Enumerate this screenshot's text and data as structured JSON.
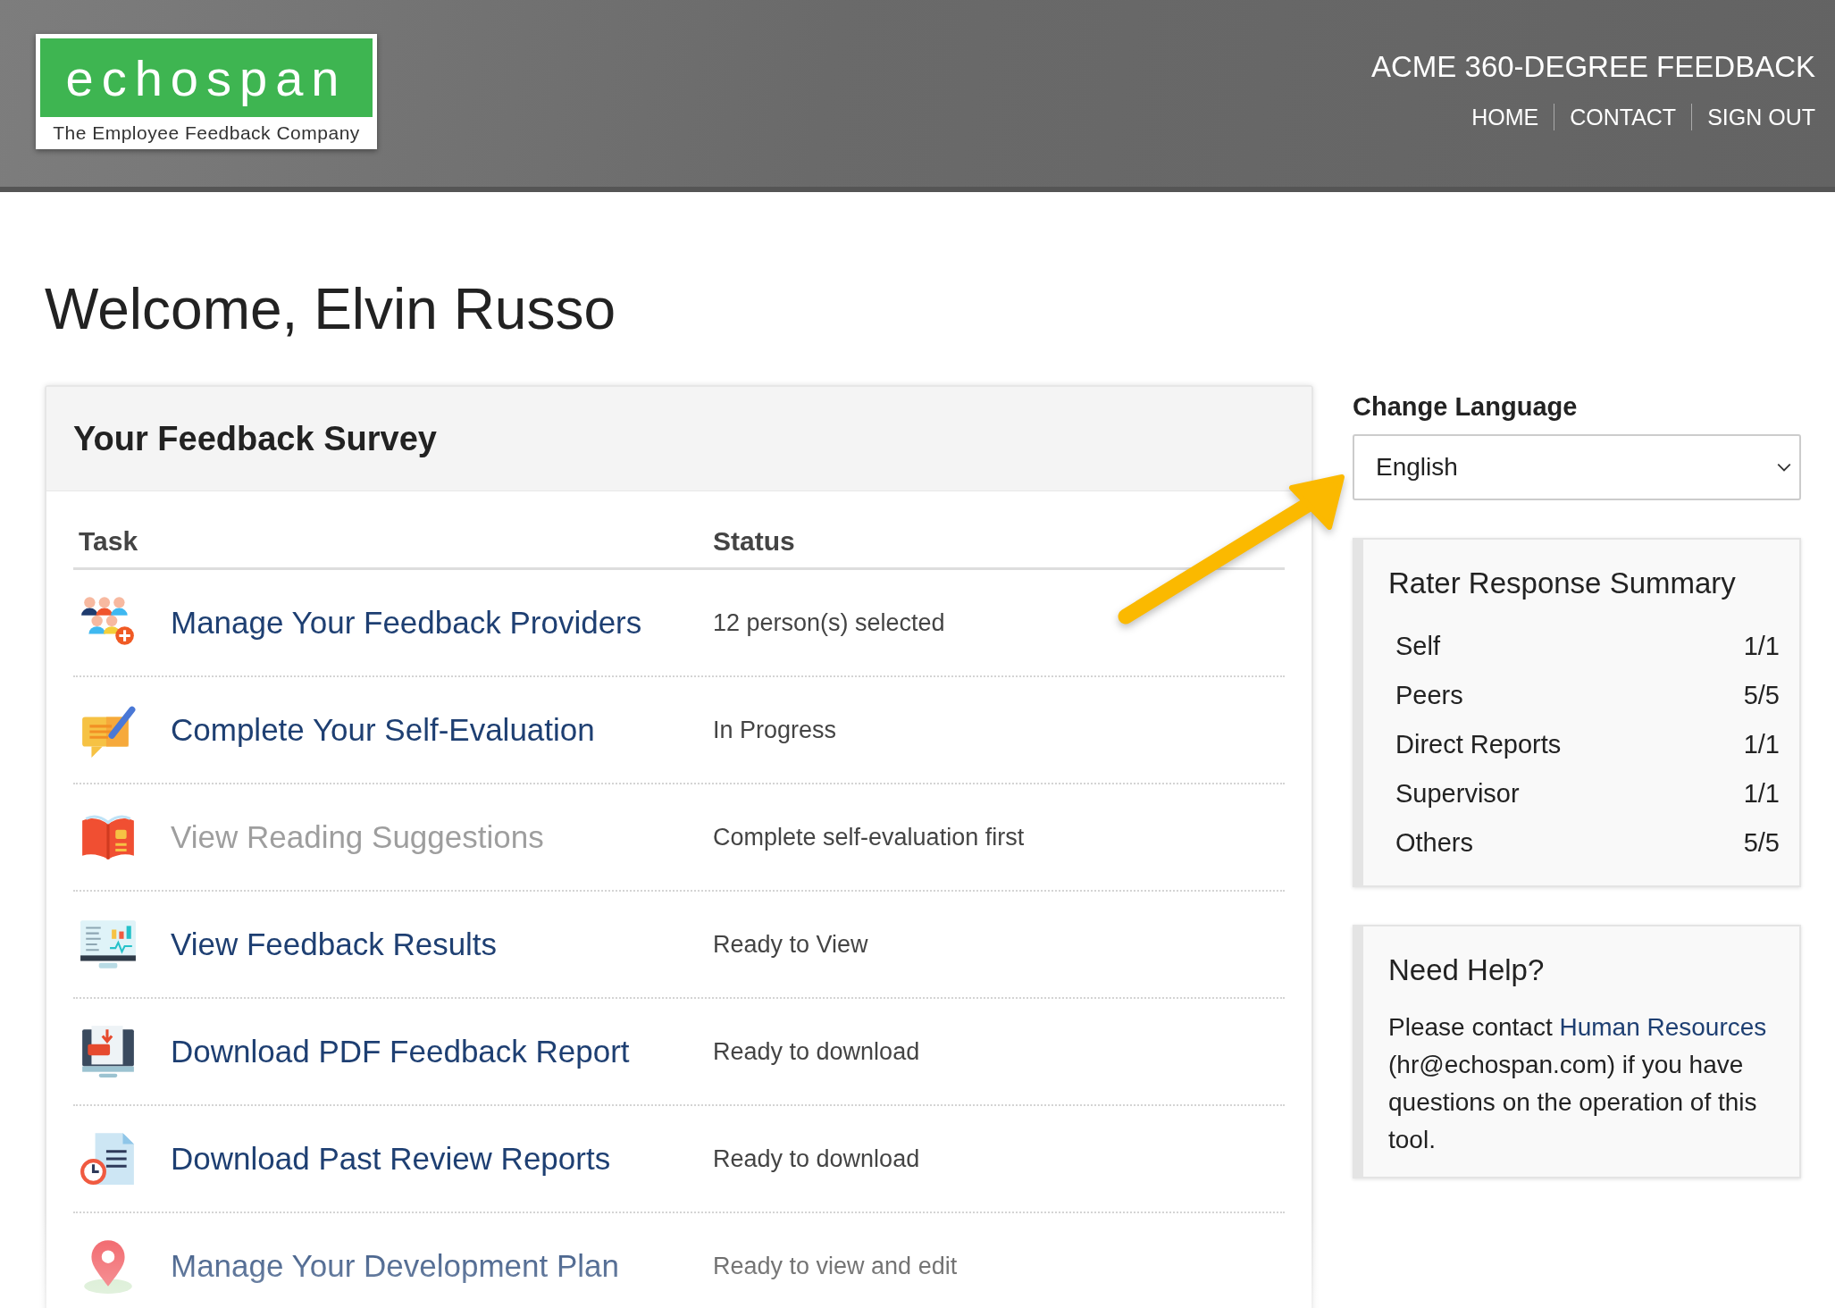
{
  "header": {
    "logo": {
      "wordmark": "echospan",
      "tagline": "The Employee Feedback Company"
    },
    "app_title": "ACME 360-DEGREE FEEDBACK",
    "nav": [
      "HOME",
      "CONTACT",
      "SIGN OUT"
    ]
  },
  "welcome": "Welcome, Elvin Russo",
  "survey": {
    "title": "Your Feedback Survey",
    "columns": [
      "Task",
      "Status"
    ],
    "tasks": [
      {
        "kind": "people",
        "label": "Manage Your Feedback Providers",
        "status": "12 person(s) selected",
        "disabled": false
      },
      {
        "kind": "edit",
        "label": "Complete Your Self-Evaluation",
        "status": "In Progress",
        "disabled": false
      },
      {
        "kind": "book",
        "label": "View Reading Suggestions",
        "status": "Complete self-evaluation first",
        "disabled": true
      },
      {
        "kind": "chart",
        "label": "View Feedback Results",
        "status": "Ready to View",
        "disabled": false
      },
      {
        "kind": "pdf",
        "label": "Download PDF Feedback Report",
        "status": "Ready to download",
        "disabled": false
      },
      {
        "kind": "history",
        "label": "Download Past Review Reports",
        "status": "Ready to download",
        "disabled": false
      },
      {
        "kind": "pin",
        "label": "Manage Your Development Plan",
        "status": "Ready to view and edit",
        "disabled": false
      }
    ]
  },
  "language": {
    "label": "Change Language",
    "value": "English"
  },
  "rater_summary": {
    "title": "Rater Response Summary",
    "rows": [
      {
        "group": "Self",
        "count": "1/1"
      },
      {
        "group": "Peers",
        "count": "5/5"
      },
      {
        "group": "Direct Reports",
        "count": "1/1"
      },
      {
        "group": "Supervisor",
        "count": "1/1"
      },
      {
        "group": "Others",
        "count": "5/5"
      }
    ]
  },
  "help": {
    "title": "Need Help?",
    "text_before": "Please contact",
    "link": "Human Resources",
    "text_after": "(hr@echospan.com) if you have questions on the operation of this tool."
  }
}
